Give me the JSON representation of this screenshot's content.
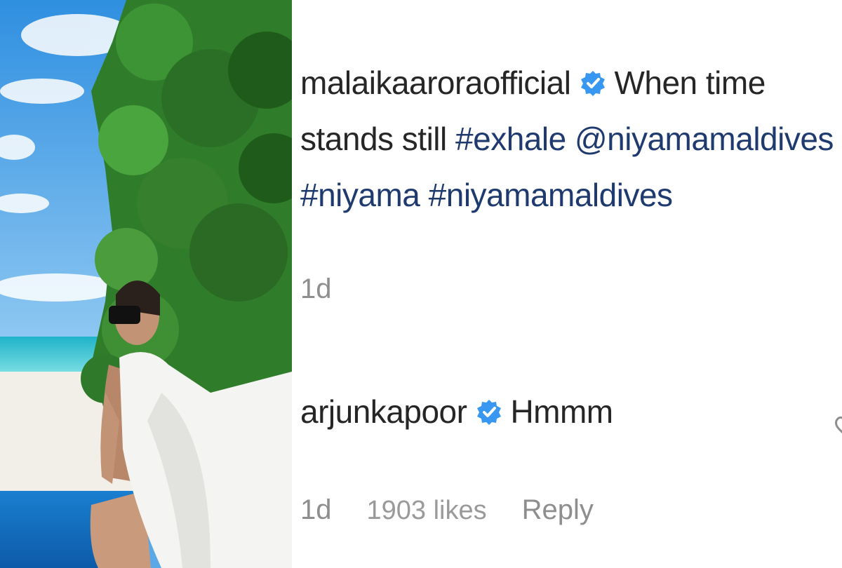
{
  "post": {
    "username": "malaikaaroraofficial",
    "verified": true,
    "caption_line1_text": "When time",
    "caption_line2_text": "stands still",
    "caption_line2_tags": "#exhale @niyamamaldives",
    "caption_line3_tags": "#niyama #niyamamaldives",
    "timestamp": "1d"
  },
  "reply_comment": {
    "username": "arjunkapoor",
    "verified": true,
    "text": "Hmmm",
    "timestamp": "1d",
    "likes": "1903 likes",
    "reply_label": "Reply"
  },
  "colors": {
    "hashtag": "#1f3a6e",
    "verified_badge": "#3897f0",
    "meta_text": "#8e8e8e",
    "text": "#262626"
  },
  "icons": {
    "verified": "verified-badge-icon",
    "like": "heart-icon"
  }
}
